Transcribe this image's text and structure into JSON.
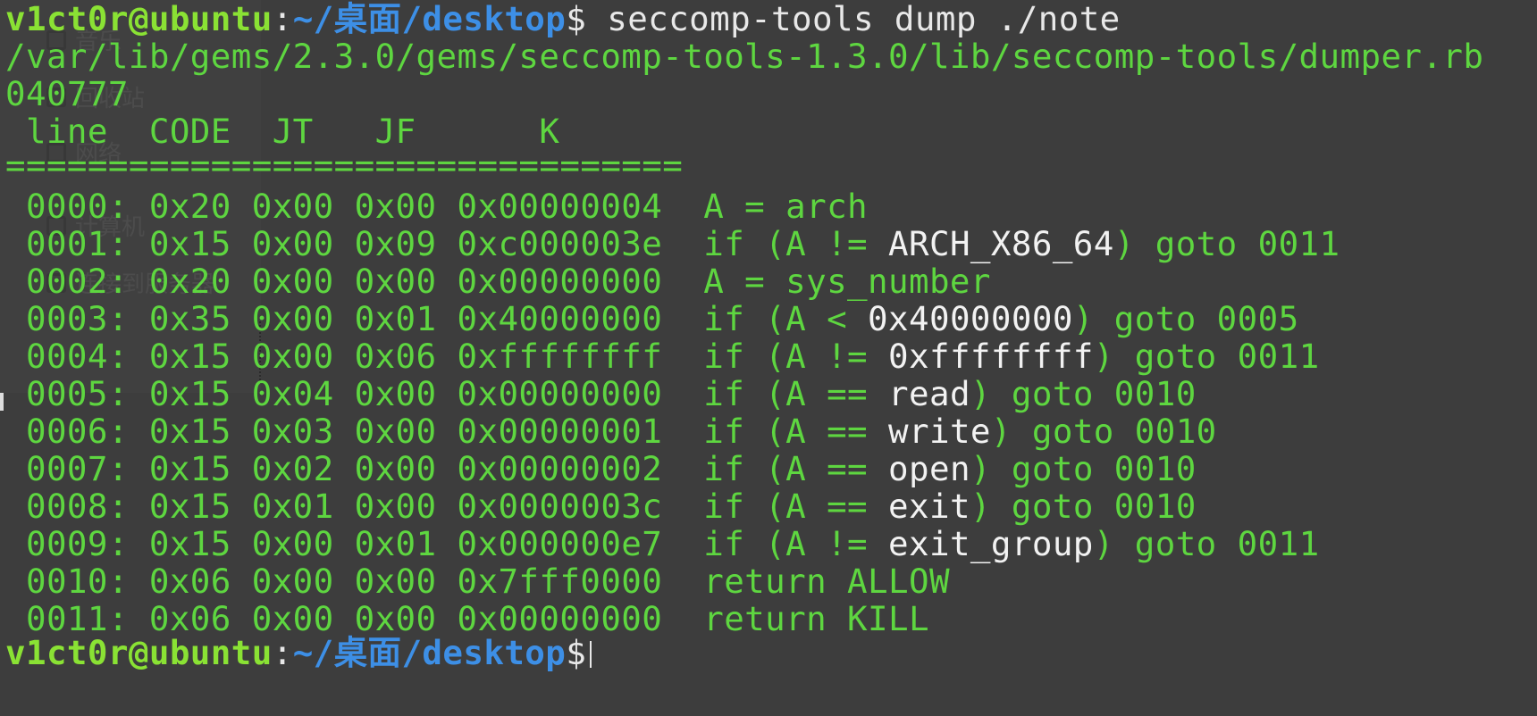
{
  "terminal": {
    "prompt": {
      "user_host": "v1ct0r@ubuntu",
      "colon": ":",
      "path": "~/桌面/desktop",
      "dollar": "$"
    },
    "command": " seccomp-tools dump ./note",
    "warning_line": "/var/lib/gems/2.3.0/gems/seccomp-tools-1.3.0/lib/seccomp-tools/dumper.rb",
    "mode_line": "040777",
    "header": " line  CODE  JT   JF      K",
    "separator": "=================================",
    "rows": [
      {
        "prefix": " 0000: 0x20 0x00 0x00 0x00000004  A = arch",
        "arg": "",
        "suffix": ""
      },
      {
        "prefix": " 0001: 0x15 0x00 0x09 0xc000003e  if (A != ",
        "arg": "ARCH_X86_64",
        "suffix": ") goto 0011"
      },
      {
        "prefix": " 0002: 0x20 0x00 0x00 0x00000000  A = sys_number",
        "arg": "",
        "suffix": ""
      },
      {
        "prefix": " 0003: 0x35 0x00 0x01 0x40000000  if (A < ",
        "arg": "0x40000000",
        "suffix": ") goto 0005"
      },
      {
        "prefix": " 0004: 0x15 0x00 0x06 0xffffffff  if (A != ",
        "arg": "0xffffffff",
        "suffix": ") goto 0011"
      },
      {
        "prefix": " 0005: 0x15 0x04 0x00 0x00000000  if (A == ",
        "arg": "read",
        "suffix": ") goto 0010"
      },
      {
        "prefix": " 0006: 0x15 0x03 0x00 0x00000001  if (A == ",
        "arg": "write",
        "suffix": ") goto 0010"
      },
      {
        "prefix": " 0007: 0x15 0x02 0x00 0x00000002  if (A == ",
        "arg": "open",
        "suffix": ") goto 0010"
      },
      {
        "prefix": " 0008: 0x15 0x01 0x00 0x0000003c  if (A == ",
        "arg": "exit",
        "suffix": ") goto 0010"
      },
      {
        "prefix": " 0009: 0x15 0x00 0x01 0x000000e7  if (A != ",
        "arg": "exit_group",
        "suffix": ") goto 0011"
      },
      {
        "prefix": " 0010: 0x06 0x00 0x00 0x7fff0000  return ALLOW",
        "arg": "",
        "suffix": ""
      },
      {
        "prefix": " 0011: 0x06 0x00 0x00 0x00000000  return KILL",
        "arg": "",
        "suffix": ""
      }
    ]
  },
  "background_sidebar": {
    "items": [
      "音乐",
      "回收站",
      "网络",
      "计算机",
      "连接到服务器"
    ]
  }
}
